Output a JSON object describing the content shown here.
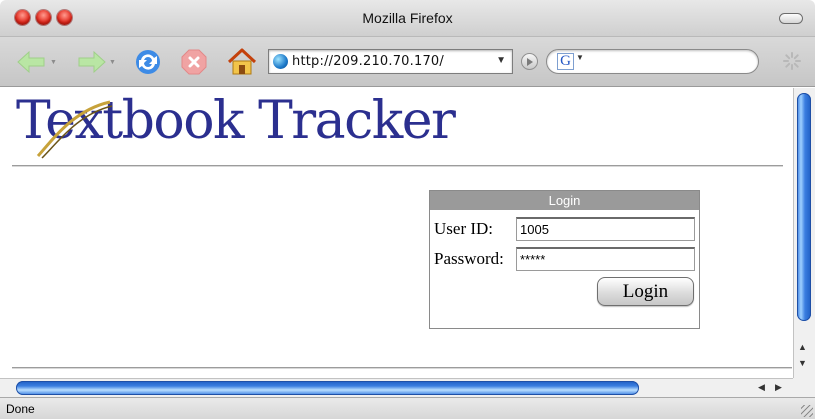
{
  "window": {
    "title": "Mozilla Firefox"
  },
  "toolbar": {
    "back_icon": "back-arrow-icon",
    "forward_icon": "forward-arrow-icon",
    "reload_icon": "reload-icon",
    "stop_icon": "stop-icon",
    "home_icon": "home-icon",
    "url": "http://209.210.70.170/",
    "search_engine_glyph": "G",
    "search_value": ""
  },
  "page": {
    "logo_text": "Textbook Tracker",
    "login": {
      "header": "Login",
      "user_id_label": "User ID:",
      "user_id_value": "1005",
      "password_label": "Password:",
      "password_value": "*****",
      "submit_label": "Login"
    }
  },
  "status": {
    "text": "Done"
  },
  "colors": {
    "logo": "#2b2f8f",
    "login_header": "#9a9a9a",
    "scroll_thumb": "#3a7ee0"
  }
}
